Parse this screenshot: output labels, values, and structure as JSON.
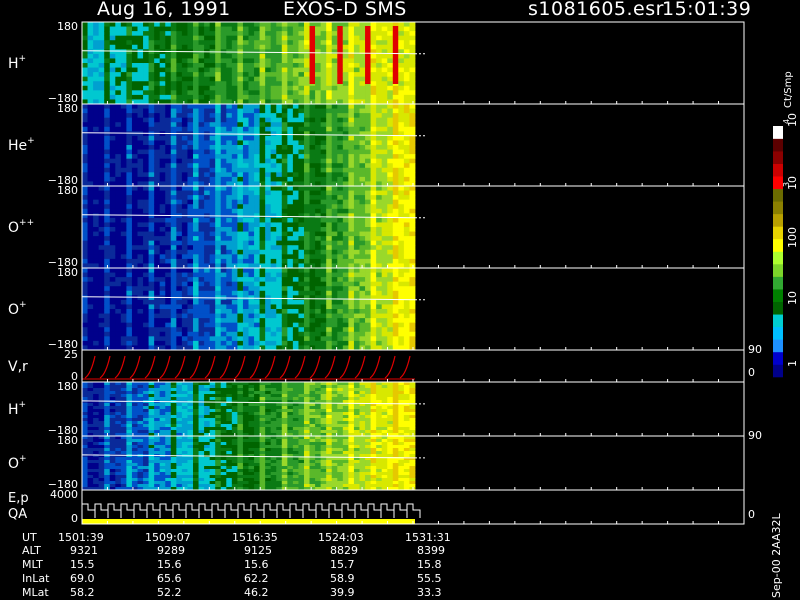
{
  "header": {
    "date": "Aug 16, 1991",
    "instrument": "EXOS-D SMS",
    "file": "s1081605.esr",
    "time": "15:01:39"
  },
  "colorbar": {
    "unit_label": "Ct/Smp",
    "tick_labels": [
      "1",
      "10",
      "100",
      "10",
      "3",
      "10",
      "4"
    ],
    "colors": [
      "#00008b",
      "#0000cd",
      "#1e90ff",
      "#00bfff",
      "#00ced1",
      "#006400",
      "#008000",
      "#32a832",
      "#7cd52a",
      "#adff2f",
      "#ffff00",
      "#e6d200",
      "#b8a000",
      "#8b8000",
      "#6b6b00",
      "#ff0000",
      "#cc0000",
      "#8b0000",
      "#5c0000",
      "#ffffff"
    ]
  },
  "footer_code": "Sep-00 2AA32L",
  "chart_data": {
    "type": "heatmap",
    "panels": [
      {
        "label": "H",
        "superscript": "+",
        "ytop": "180",
        "ybot": "−180",
        "base_color": "#1a7f4a"
      },
      {
        "label": "He",
        "superscript": "+",
        "ytop": "180",
        "ybot": "−180",
        "base_color": "#0a2a8a"
      },
      {
        "label": "O",
        "superscript": "++",
        "ytop": "180",
        "ybot": "−180",
        "base_color": "#0a2a8a"
      },
      {
        "label": "O",
        "superscript": "+",
        "ytop": "180",
        "ybot": "−180",
        "base_color": "#0a2a8a"
      },
      {
        "label": "V,r",
        "superscript": "",
        "ytop": "25",
        "ybot": "0",
        "right_top": "90",
        "right_bot": "0"
      },
      {
        "label": "H",
        "superscript": "+",
        "ytop": "180",
        "ybot": "−180"
      },
      {
        "label": "O",
        "superscript": "+",
        "ytop": "180",
        "ybot": "−180",
        "right_top": "90"
      },
      {
        "label": "E,p",
        "label2": "QA",
        "superscript": "",
        "ytop": "4000",
        "ybot": "0",
        "right_bot": "0"
      }
    ],
    "time_axis": {
      "row_labels": [
        "UT",
        "ALT",
        "MLT",
        "InLat",
        "MLat"
      ],
      "ticks": [
        {
          "UT": "1501:39",
          "ALT": "9321",
          "MLT": "15.5",
          "InLat": "69.0",
          "MLat": "58.2"
        },
        {
          "UT": "1509:07",
          "ALT": "9289",
          "MLT": "15.6",
          "InLat": "65.6",
          "MLat": "52.2"
        },
        {
          "UT": "1516:35",
          "ALT": "9125",
          "MLT": "15.6",
          "InLat": "62.2",
          "MLat": "46.2"
        },
        {
          "UT": "1524:03",
          "ALT": "8829",
          "MLT": "15.7",
          "InLat": "58.9",
          "MLat": "39.9"
        },
        {
          "UT": "1531:31",
          "ALT": "8399",
          "MLT": "15.8",
          "InLat": "55.5",
          "MLat": "33.3"
        }
      ]
    },
    "data_fraction": 0.5,
    "progression": "counts increase from left (low, blue) to right (high, yellow/red)"
  }
}
